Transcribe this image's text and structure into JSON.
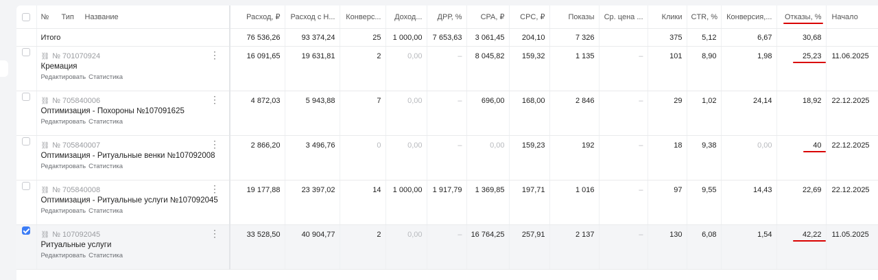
{
  "header": {
    "num": "№",
    "type": "Тип",
    "name": "Название",
    "columns": [
      "Расход, ₽",
      "Расход с Н...",
      "Конверс...",
      "Доход...",
      "ДРР, %",
      "CPA, ₽",
      "CPC, ₽",
      "Показы",
      "Ср. цена ...",
      "Клики",
      "CTR, %",
      "Конверсия,...",
      "Отказы, %",
      "Начало"
    ]
  },
  "total": {
    "label": "Итого",
    "values": [
      "76 536,26",
      "93 374,24",
      "25",
      "1 000,00",
      "7 653,63",
      "3 061,45",
      "204,10",
      "7 326",
      "",
      "375",
      "5,12",
      "6,67",
      "30,68",
      ""
    ]
  },
  "actions": {
    "edit": "Редактировать",
    "stats": "Статистика"
  },
  "rows": [
    {
      "id": "№ 701070924",
      "name": "Кремация",
      "checked": false,
      "values": [
        "16 091,65",
        "19 631,81",
        "2",
        "0,00",
        "–",
        "8 045,82",
        "159,32",
        "1 135",
        "–",
        "101",
        "8,90",
        "1,98",
        "25,23",
        "11.06.2025"
      ]
    },
    {
      "id": "№ 705840006",
      "name": "Оптимизация - Похороны №107091625",
      "checked": false,
      "values": [
        "4 872,03",
        "5 943,88",
        "7",
        "0,00",
        "–",
        "696,00",
        "168,00",
        "2 846",
        "–",
        "29",
        "1,02",
        "24,14",
        "18,92",
        "22.12.2025"
      ]
    },
    {
      "id": "№ 705840007",
      "name": "Оптимизация - Ритуальные венки №107092008",
      "checked": false,
      "values": [
        "2 866,20",
        "3 496,76",
        "0",
        "0,00",
        "–",
        "0,00",
        "159,23",
        "192",
        "–",
        "18",
        "9,38",
        "0,00",
        "40",
        "22.12.2025"
      ]
    },
    {
      "id": "№ 705840008",
      "name": "Оптимизация - Ритуальные услуги №107092045",
      "checked": false,
      "values": [
        "19 177,88",
        "23 397,02",
        "14",
        "1 000,00",
        "1 917,79",
        "1 369,85",
        "197,71",
        "1 016",
        "–",
        "97",
        "9,55",
        "14,43",
        "22,69",
        "22.12.2025"
      ]
    },
    {
      "id": "№ 107092045",
      "name": "Ритуальные услуги",
      "checked": true,
      "values": [
        "33 528,50",
        "40 904,77",
        "2",
        "0,00",
        "–",
        "16 764,25",
        "257,91",
        "2 137",
        "–",
        "130",
        "6,08",
        "1,54",
        "42,22",
        "11.05.2025"
      ]
    }
  ]
}
